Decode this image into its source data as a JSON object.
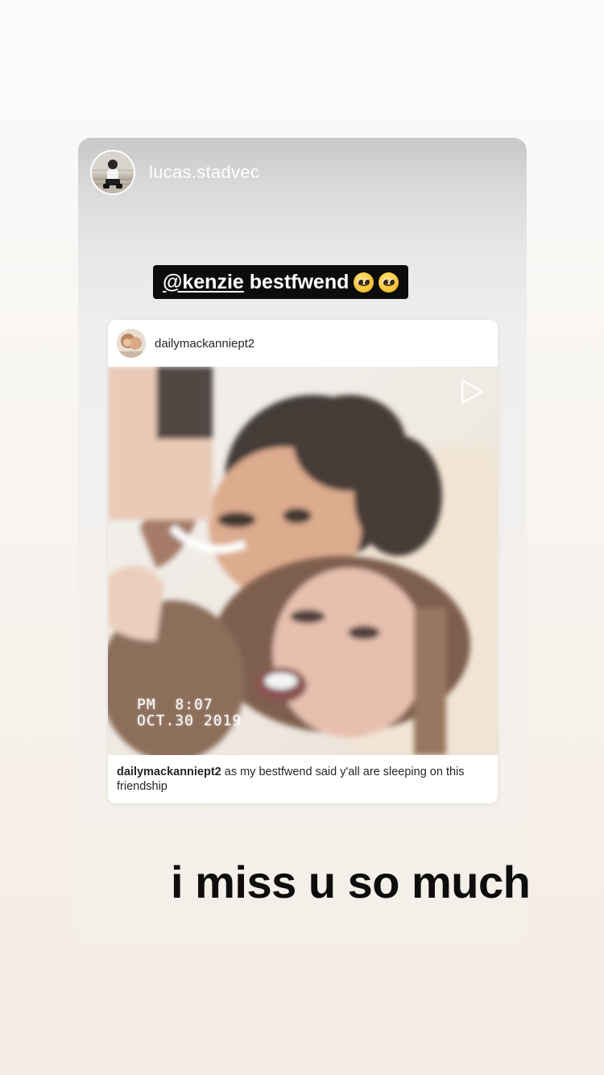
{
  "shared_post": {
    "author_username": "lucas.stadvec",
    "mention_sticker": {
      "mention": "@kenzie",
      "text": " bestfwend",
      "emojis": [
        "pleading-face-icon",
        "pleading-face-icon"
      ]
    },
    "embedded_post": {
      "username": "dailymackanniept2",
      "media_type": "video",
      "video_timestamp": "PM  8:07\nOCT.30 2019",
      "caption_username": "dailymackanniept2",
      "caption_text": "as my bestfwend said y'all are sleeping on this friendship"
    }
  },
  "story_text": "i miss u so much",
  "colors": {
    "sticker_bg": "#0c0c0c",
    "sticker_text": "#ffffff",
    "overlay_text": "#0d0d0d"
  }
}
